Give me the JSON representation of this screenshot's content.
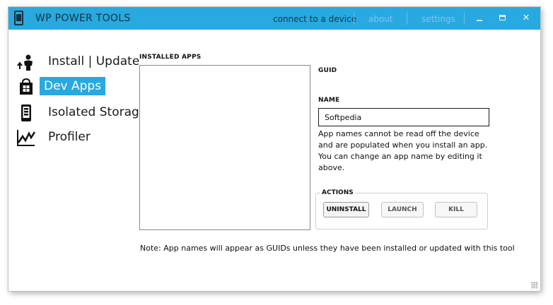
{
  "window": {
    "title": "WP POWER TOOLS",
    "nav": {
      "connect": "connect to a device",
      "about": "about",
      "settings": "settings"
    },
    "controls": {
      "close_glyph": "✕"
    }
  },
  "sidebar": {
    "items": [
      {
        "label": "Install | Update",
        "icon": "person-upload-icon",
        "selected": false
      },
      {
        "label": "Dev Apps",
        "icon": "store-bag-icon",
        "selected": true
      },
      {
        "label": "Isolated Storage",
        "icon": "phone-storage-icon",
        "selected": false
      },
      {
        "label": "Profiler",
        "icon": "chart-line-icon",
        "selected": false
      }
    ]
  },
  "main": {
    "installed_apps_label": "INSTALLED APPS",
    "guid_label": "GUID",
    "name_label": "NAME",
    "name_value": "Softpedia",
    "help_text": "App names cannot be read off the device and are populated when you install an app. You can change an app name by editing it above.",
    "actions_label": "ACTIONS",
    "buttons": {
      "uninstall": "UNINSTALL",
      "launch": "LAUNCH",
      "kill": "KILL"
    },
    "note": "Note: App names will appear as GUIDs unless they have been installed or updated with this tool"
  },
  "colors": {
    "accent": "#28a9e0",
    "title_text": "#14323f"
  }
}
